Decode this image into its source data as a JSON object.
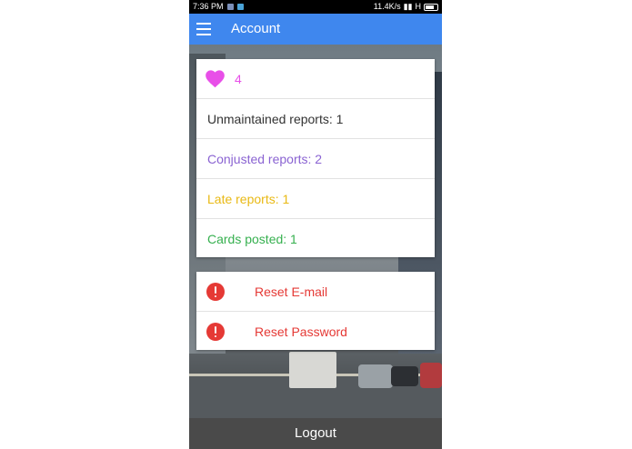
{
  "status_bar": {
    "time": "7:36 PM",
    "net_speed": "11.4K/s",
    "network_type": "H"
  },
  "app_bar": {
    "title": "Account"
  },
  "stats": {
    "likes": "4",
    "unmaintained": "Unmaintained reports: 1",
    "congested": "Conjusted reports: 2",
    "late": "Late reports: 1",
    "cards": "Cards posted: 1"
  },
  "actions": {
    "reset_email": "Reset E-mail",
    "reset_password": "Reset Password"
  },
  "logout_label": "Logout",
  "colors": {
    "app_bar": "#3f87ee",
    "likes": "#e84fe8",
    "congested": "#8a63d2",
    "late": "#e9b914",
    "cards": "#36b04f",
    "danger": "#e53935",
    "logout_bar": "#4a4a4a"
  },
  "icons": [
    "menu-icon",
    "heart-icon",
    "alert-icon"
  ]
}
